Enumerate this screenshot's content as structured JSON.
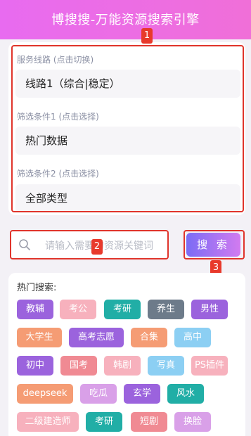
{
  "header": {
    "title": "博搜搜-万能资源搜索引擎"
  },
  "settings": {
    "server_label": "服务线路 (点击切换)",
    "server_value": "线路1（综合|稳定）",
    "filter1_label": "筛选条件1 (点击选择)",
    "filter1_value": "热门数据",
    "filter2_label": "筛选条件2 (点击选择)",
    "filter2_value": "全部类型"
  },
  "search": {
    "icon": "search-icon",
    "placeholder": "请输入需要的资源关键词",
    "button_label": "搜 索"
  },
  "annotations": {
    "badge1": "1",
    "badge2": "2",
    "badge3": "3"
  },
  "hot": {
    "title": "热门搜索:",
    "tags": [
      {
        "label": "教辅",
        "color": "#9b63dd"
      },
      {
        "label": "考公",
        "color": "#f7b1bd"
      },
      {
        "label": "考研",
        "color": "#21aea6"
      },
      {
        "label": "养生",
        "color": "#6d7b8a"
      },
      {
        "label": "男性",
        "color": "#9b63dd"
      },
      {
        "label": "大学生",
        "color": "#f59c74"
      },
      {
        "label": "高考志愿",
        "color": "#9b63dd"
      },
      {
        "label": "合集",
        "color": "#f59c74"
      },
      {
        "label": "高中",
        "color": "#8ccff3"
      },
      {
        "label": "初中",
        "color": "#9b63dd"
      },
      {
        "label": "国考",
        "color": "#f08a93"
      },
      {
        "label": "韩剧",
        "color": "#f7b1bd"
      },
      {
        "label": "写真",
        "color": "#8ccff3"
      },
      {
        "label": "PS插件",
        "color": "#f7b1bd"
      },
      {
        "label": "deepseek",
        "color": "#f59c74"
      },
      {
        "label": "吃瓜",
        "color": "#d9a0e8"
      },
      {
        "label": "玄学",
        "color": "#9b63dd"
      },
      {
        "label": "风水",
        "color": "#21aea6"
      },
      {
        "label": "二级建造师",
        "color": "#f7b1bd"
      },
      {
        "label": "考研",
        "color": "#21aea6"
      },
      {
        "label": "短剧",
        "color": "#f08a93"
      },
      {
        "label": "换脸",
        "color": "#d9a0e8"
      }
    ]
  }
}
